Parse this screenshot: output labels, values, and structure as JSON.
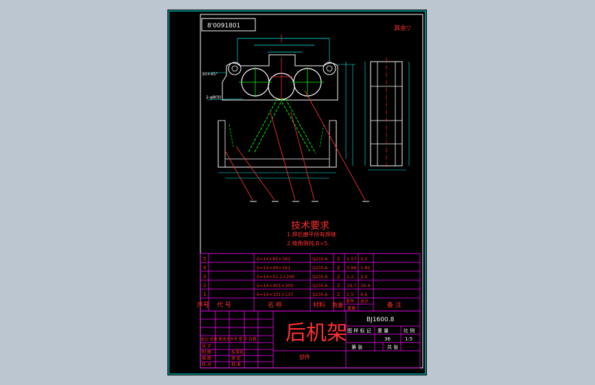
{
  "colors": {
    "background": "#bcc6d0",
    "sheet": "#000000",
    "frame": "#ffffff",
    "table": "#ff00ff",
    "text_red": "#ff3030",
    "geometry": "#00ffff",
    "center_lines": "#ff3030",
    "hidden": "#00ff00",
    "leader": "#ff3030"
  },
  "header": {
    "code_box": "8'0091801",
    "roughness_note": "其余▽"
  },
  "dimensions": {
    "chamfer": "30×45°",
    "holes": "2-φ8(9)"
  },
  "tech_requirements": {
    "title": "技术要求",
    "items": [
      "1.焊后磨平所有焊缝",
      "2.棱角倒钝,R=5."
    ]
  },
  "parts_list": {
    "headers": {
      "no": "序号",
      "code": "代 号",
      "name": "名 称",
      "material": "材料",
      "qty": "数量",
      "unit_weight": "单件",
      "total_weight": "总计",
      "weight": "重量",
      "remark": "备 注"
    },
    "rows": [
      {
        "no": "5",
        "name": "δ=14×85×161",
        "material": "Q235-A",
        "qty": "2",
        "unit": "1.57",
        "total": "3.2"
      },
      {
        "no": "4",
        "name": "δ=14×40×161",
        "material": "Q235-A",
        "qty": "2",
        "unit": "0.86",
        "total": "1.82"
      },
      {
        "no": "3",
        "name": "δ=14×51.1×295",
        "material": "Q235-A",
        "qty": "2",
        "unit": "1.2",
        "total": "3.4"
      },
      {
        "no": "2",
        "name": "δ=14×401×300",
        "material": "Q235-A",
        "qty": "2",
        "unit": "19.7",
        "total": "39.4"
      },
      {
        "no": "1",
        "name": "δ=14×101×137",
        "material": "Q235-A",
        "qty": "2",
        "unit": "2.5",
        "total": "4.6"
      }
    ]
  },
  "title_block": {
    "part_name": "后机架",
    "drawing_no": "BJ1600.8",
    "stage_header": "图 样 标 记",
    "weight_header": "重 量",
    "scale_header": "比 例",
    "weight_value": "36",
    "scale_value": "1:5",
    "sheet_label": "第   张",
    "total_label": "共   张",
    "change_row": "标记 处数 更改文件号 签 字 日期",
    "roles": [
      "设 计",
      "制 图",
      "描 图",
      "校 对",
      "审 核"
    ],
    "sign_roles": [
      "标准化",
      "审 定",
      "批 准"
    ],
    "assembly_note": "部件"
  }
}
